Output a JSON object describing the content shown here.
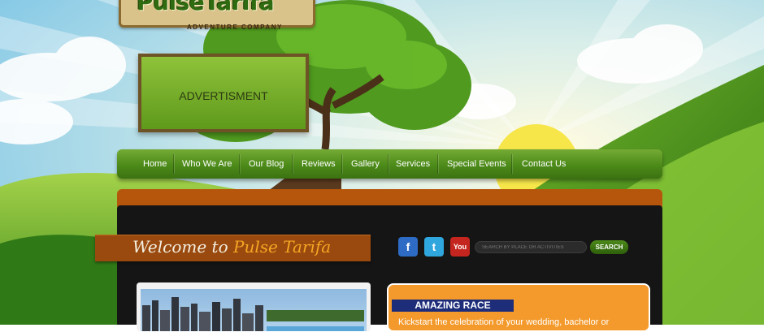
{
  "logo": {
    "name": "PulseTarifa",
    "tagline": "ADVENTURE COMPANY"
  },
  "advert": {
    "label": "ADVERTISMENT"
  },
  "nav": {
    "items": [
      "Home",
      "Who We Are",
      "Our Blog",
      "Reviews",
      "Gallery",
      "Services",
      "Special Events",
      "Contact Us"
    ]
  },
  "welcome": {
    "prefix": "Welcome to",
    "brand": "Pulse Tarifa"
  },
  "social": {
    "facebook": "f",
    "twitter": "t",
    "youtube": "You"
  },
  "search": {
    "placeholder": "SEARCH BY PLACE OR ACTIVITIES",
    "button": "SEARCH"
  },
  "featured": {
    "title": "AMAZING RACE",
    "text": "Kickstart the celebration of your wedding, bachelor or"
  },
  "colors": {
    "nav_green": "#4c8a19",
    "orange_bar": "#b6560c",
    "panel": "#151515",
    "race_card": "#f49a2c",
    "race_title": "#1d2d7a"
  }
}
